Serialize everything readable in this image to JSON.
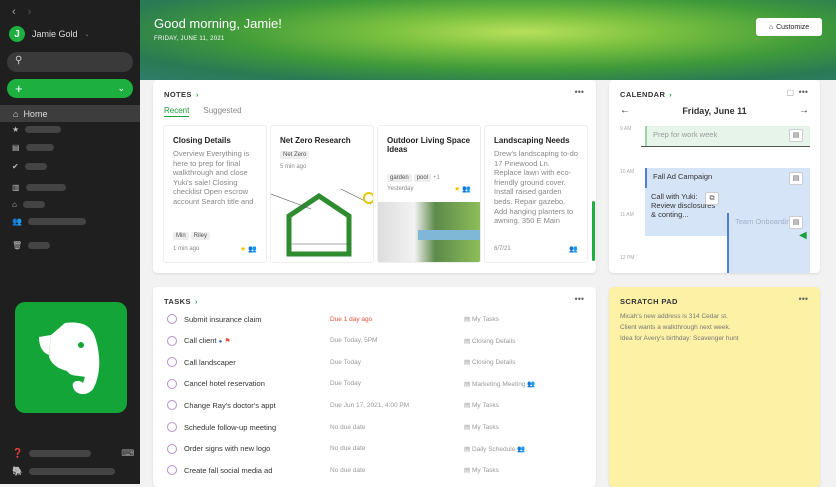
{
  "sidebar": {
    "user": "Jamie Gold",
    "avatar_initial": "J",
    "home": "Home",
    "new_icon": "+"
  },
  "header": {
    "greeting": "Good morning, Jamie!",
    "date": "FRIDAY, JUNE 11, 2021",
    "customize": "Customize"
  },
  "notes": {
    "title": "NOTES",
    "tabs": [
      "Recent",
      "Suggested"
    ],
    "items": [
      {
        "title": "Closing Details",
        "body": "Overview Everything is here to prep for final walkthrough and close Yuki's sale! Closing checklist Open escrow account Search title and",
        "tags": [
          "Min",
          "Riley"
        ],
        "time": "1 min ago",
        "starred": true,
        "shared": true
      },
      {
        "title": "Net Zero Research",
        "tags": [
          "Net Zero"
        ],
        "time": "5 min ago"
      },
      {
        "title": "Outdoor Living Space Ideas",
        "tags": [
          "garden",
          "pool"
        ],
        "more_tags": "+1",
        "time": "Yesterday",
        "starred": true,
        "shared": true
      },
      {
        "title": "Landscaping Needs",
        "body": "Drew's landscaping to-do 17 Pinewood Ln. Replace lawn with eco-friendly ground cover. Install raised garden beds. Repair gazebo. Add hanging planters to awning. 350 E Main",
        "time": "6/7/21",
        "shared": true
      }
    ]
  },
  "calendar": {
    "title": "CALENDAR",
    "day": "Friday, June 11",
    "times": [
      "9 AM",
      "10 AM",
      "11 AM",
      "12 PM"
    ],
    "events": [
      "Prep for work week",
      "Fall Ad Campaign",
      "Call with Yuki: Review disclosures & conting...",
      "Team Onboarding"
    ]
  },
  "tasks": {
    "title": "TASKS",
    "items": [
      {
        "name": "Submit insurance claim",
        "due": "Due 1 day ago",
        "note": "My Tasks",
        "overdue": true
      },
      {
        "name": "Call client",
        "due": "Due Today, 5PM",
        "note": "Closing Details",
        "flag": true
      },
      {
        "name": "Call landscaper",
        "due": "Due Today",
        "note": "Closing Details"
      },
      {
        "name": "Cancel hotel reservation",
        "due": "Due Today",
        "note": "Marketing Meeting",
        "shared": true
      },
      {
        "name": "Change Ray's doctor's appt",
        "due": "Due Jun 17, 2021, 4:00 PM",
        "note": "My Tasks"
      },
      {
        "name": "Schedule follow-up meeting",
        "due": "No due date",
        "note": "My Tasks"
      },
      {
        "name": "Order signs with new logo",
        "due": "No due date",
        "note": "Daily Schedule",
        "shared": true
      },
      {
        "name": "Create fall social media ad",
        "due": "No due date",
        "note": "My Tasks"
      }
    ]
  },
  "scratch": {
    "title": "SCRATCH PAD",
    "lines": [
      "Micah's new address is 314 Cedar st.",
      "Client wants a walkthrough next week.",
      "Idea for Avery's birthday: Scavenger hunt"
    ]
  },
  "colors": {
    "accent": "#1db03f",
    "sidebar": "#1f1f1f",
    "scratch": "#fdf1a6",
    "overdue": "#e0533d",
    "event": "#d6e4f7"
  }
}
